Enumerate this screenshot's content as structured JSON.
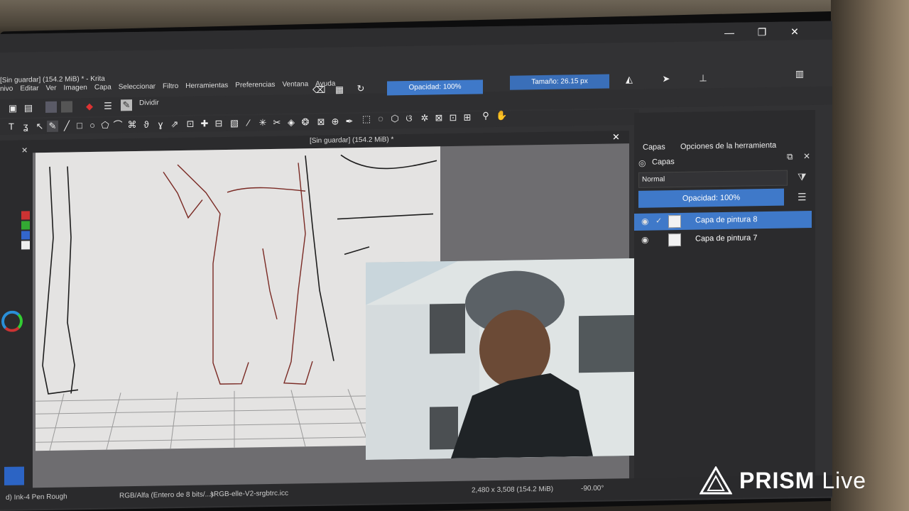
{
  "window": {
    "title": "[Sin guardar] (154.2 MiB) * - Krita",
    "minimize": "—",
    "maximize": "❐",
    "close": "✕"
  },
  "menu": [
    "nivo",
    "Editar",
    "Ver",
    "Imagen",
    "Capa",
    "Seleccionar",
    "Filtro",
    "Herramientas",
    "Preferencias",
    "Ventana",
    "Ayuda"
  ],
  "toolbar": {
    "opacity_label": "Opacidad: 100%",
    "size_label": "Tamaño: 26.15 px",
    "dividir": "Dividir"
  },
  "canvas": {
    "doc_title": "[Sin guardar] (154.2 MiB) *"
  },
  "docker": {
    "tab_layers": "Capas",
    "tab_tool_options": "Opciones de la herramienta",
    "layers_header": "Capas",
    "blend_mode": "Normal",
    "layer_opacity": "Opacidad: 100%",
    "layers": [
      {
        "name": "Capa de pintura 8",
        "selected": true
      },
      {
        "name": "Capa de pintura 7",
        "selected": false
      }
    ]
  },
  "status": {
    "brush": "d) Ink-4 Pen Rough",
    "color_space": "RGB/Alfa (Entero de 8 bits/...)",
    "profile": "sRGB-elle-V2-srgbtrc.icc",
    "dimensions": "2,480 x 3,508 (154.2 MiB)",
    "rotation": "-90.00°"
  },
  "overlay": {
    "brand": "PRISM",
    "brand_suffix": "Live"
  },
  "colors": {
    "accent": "#3f79c9",
    "panel": "#2b2b2d",
    "canvas": "#e4e3e2"
  }
}
